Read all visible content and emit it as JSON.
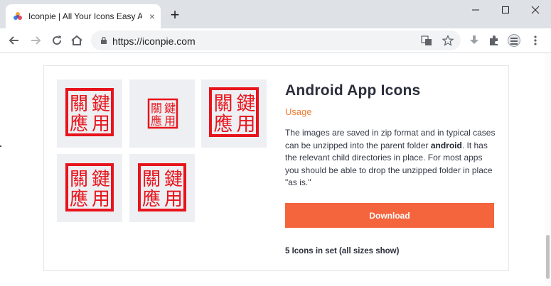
{
  "browser": {
    "tab_title": "Iconpie | All Your Icons Easy As",
    "tab_close": "×",
    "new_tab": "+",
    "url": "https://iconpie.com"
  },
  "product": {
    "title": "Android App Icons",
    "usage_label": "Usage",
    "description_part1": "The images are saved in zip format and in typical cases can be unzipped into the parent folder ",
    "description_bold": "android",
    "description_part2": ". It has the relevant child directories in place. For most apps you should be able to drop the unzipped folder in place \"as is.\"",
    "download_label": "Download",
    "count_text": "5 Icons in set (all sizes show)",
    "icon_glyphs": [
      "鍵",
      "用",
      "關",
      "應"
    ]
  },
  "colors": {
    "accent": "#f4643d",
    "usage": "#f27b32",
    "seal_red": "#e8141c",
    "tile_bg": "#eeeff2"
  }
}
